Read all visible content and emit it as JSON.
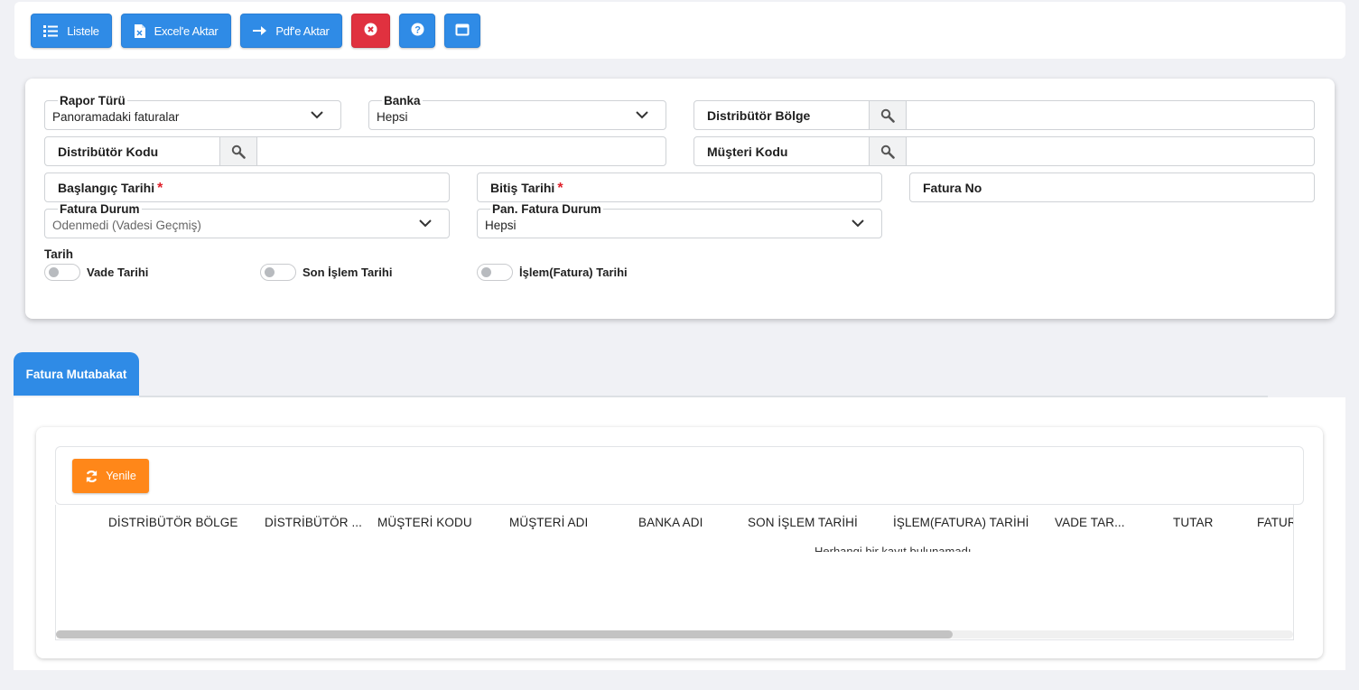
{
  "toolbar": {
    "listele": "Listele",
    "excel": "Excel'e Aktar",
    "pdf": "Pdf'e Aktar"
  },
  "filters": {
    "rapor_turu": {
      "label": "Rapor Türü",
      "value": "Panoramadaki faturalar"
    },
    "banka": {
      "label": "Banka",
      "value": "Hepsi"
    },
    "distributor_bolge": {
      "label": "Distribütör Bölge"
    },
    "distributor_kodu": {
      "label": "Distribütör Kodu"
    },
    "musteri_kodu": {
      "label": "Müşteri Kodu"
    },
    "baslangic_tarihi": {
      "label": "Başlangıç Tarihi",
      "required": "*"
    },
    "bitis_tarihi": {
      "label": "Bitiş Tarihi",
      "required": "*"
    },
    "fatura_no": {
      "label": "Fatura No"
    },
    "fatura_durum": {
      "label": "Fatura Durum",
      "value": "Odenmedi (Vadesi Geçmiş)"
    },
    "pan_fatura_durum": {
      "label": "Pan. Fatura Durum",
      "value": "Hepsi"
    },
    "tarih": {
      "label": "Tarih",
      "options": [
        "Vade Tarihi",
        "Son İşlem Tarihi",
        "İşlem(Fatura) Tarihi"
      ]
    }
  },
  "tabs": [
    {
      "label": "Fatura Mutabakat"
    }
  ],
  "grid": {
    "refresh_label": "Yenile",
    "columns": [
      "DİSTRİBÜTÖR BÖLGE",
      "DİSTRİBÜTÖR ...",
      "MÜŞTERİ KODU",
      "MÜŞTERİ ADI",
      "BANKA ADI",
      "SON İŞLEM TARİHİ",
      "İŞLEM(FATURA) TARİHİ",
      "VADE TAR...",
      "TUTAR",
      "FATUR"
    ],
    "empty_message": "Herhangi bir kayıt bulunamadı"
  },
  "colors": {
    "primary": "#2f8be6",
    "danger": "#e0313f",
    "warning": "#ff8719"
  }
}
